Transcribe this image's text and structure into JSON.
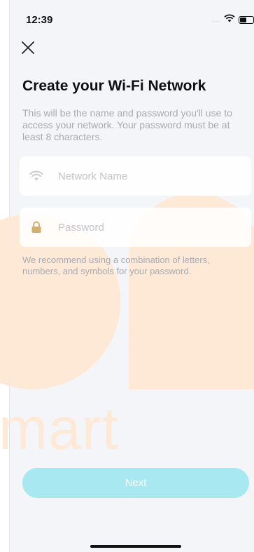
{
  "status_bar": {
    "time": "12:39",
    "signal": "....",
    "wifi_icon": "wifi-icon",
    "battery_icon": "battery-icon"
  },
  "header": {
    "close_icon": "close-icon",
    "title": "Create your Wi-Fi Network",
    "description": "This will be the name and password you'll use to access your network. Your password must be at least 8 characters."
  },
  "form": {
    "network_name": {
      "icon": "wifi-icon",
      "placeholder": "Network Name",
      "value": ""
    },
    "password": {
      "icon": "lock-icon",
      "placeholder": "Password",
      "value": ""
    },
    "hint": "We recommend using a combination of letters, numbers, and symbols for your password."
  },
  "actions": {
    "next_label": "Next"
  },
  "watermark": {
    "text": "mart",
    "color": "#fde9d6"
  },
  "colors": {
    "accent": "#a8e8f1",
    "background": "#f4f5f8",
    "muted_text": "#a9abb2"
  }
}
